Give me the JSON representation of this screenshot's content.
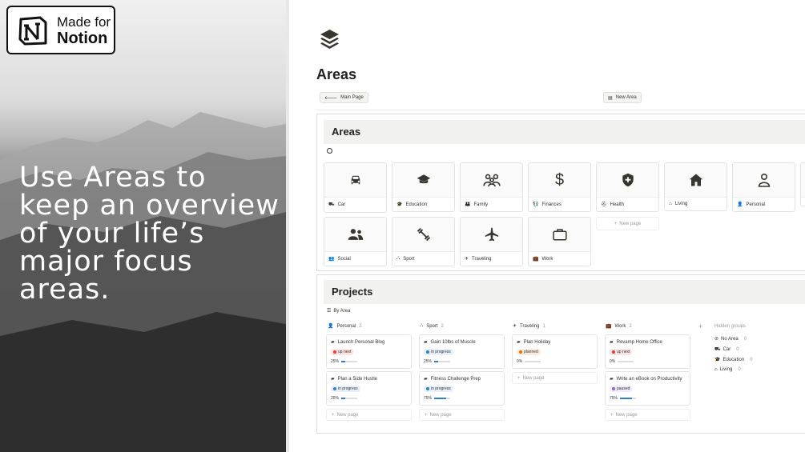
{
  "badge": {
    "line1": "Made for",
    "line2": "Notion",
    "logo_icon": "notion-logo-icon"
  },
  "headline": "Use Areas to keep an overview of your life’s major focus areas.",
  "page": {
    "title": "Areas",
    "icon": "layers-icon",
    "buttons": {
      "main_page": "Main Page",
      "new_area": "New Area"
    }
  },
  "areas": {
    "header": "Areas",
    "cards": [
      {
        "label": "Car",
        "icon": "car-icon"
      },
      {
        "label": "Education",
        "icon": "graduation-cap-icon"
      },
      {
        "label": "Family",
        "icon": "family-icon"
      },
      {
        "label": "Finances",
        "icon": "dollar-icon"
      },
      {
        "label": "Health",
        "icon": "shield-plus-icon"
      },
      {
        "label": "Living",
        "icon": "home-icon"
      },
      {
        "label": "Personal",
        "icon": "person-icon"
      },
      {
        "label": "Social",
        "icon": "people-icon"
      },
      {
        "label": "Sport",
        "icon": "dumbbell-icon"
      },
      {
        "label": "Traveling",
        "icon": "airplane-icon"
      },
      {
        "label": "Work",
        "icon": "briefcase-icon"
      }
    ],
    "new_page": "New page"
  },
  "projects": {
    "header": "Projects",
    "view": "By Area",
    "hidden_groups_label": "Hidden groups",
    "new_page": "New page",
    "columns": [
      {
        "name": "Personal",
        "count": "2",
        "cards": [
          {
            "title": "Launch Personal Blog",
            "status": "up next",
            "progress": 0.25,
            "progress_label": "25%"
          },
          {
            "title": "Plan a Side Hustle",
            "status": "in progress",
            "progress": 0.25,
            "progress_label": "25%"
          }
        ]
      },
      {
        "name": "Sport",
        "count": "2",
        "cards": [
          {
            "title": "Gain 10lbs of Muscle",
            "status": "in progress",
            "progress": 0.25,
            "progress_label": "25%"
          },
          {
            "title": "Fitness Challenge Prep",
            "status": "in progress",
            "progress": 0.75,
            "progress_label": "75%"
          }
        ]
      },
      {
        "name": "Traveling",
        "count": "1",
        "cards": [
          {
            "title": "Plan Holiday",
            "status": "planned",
            "progress": 0,
            "progress_label": "0%"
          }
        ]
      },
      {
        "name": "Work",
        "count": "2",
        "cards": [
          {
            "title": "Revamp Home Office",
            "status": "up next",
            "progress": 0,
            "progress_label": "0%"
          },
          {
            "title": "Write an eBook on Productivity",
            "status": "paused",
            "progress": 0.75,
            "progress_label": "75%"
          }
        ]
      }
    ],
    "hidden_groups": [
      {
        "name": "No Area",
        "count": "0"
      },
      {
        "name": "Car",
        "count": "0"
      },
      {
        "name": "Education",
        "count": "0"
      },
      {
        "name": "Living",
        "count": "0"
      }
    ]
  },
  "status_colors": {
    "up next": {
      "bg": "#fbe4e4",
      "dot": "#e03e3e"
    },
    "in progress": {
      "bg": "#e7f0fa",
      "dot": "#2f7fc1"
    },
    "planned": {
      "bg": "#fbecdd",
      "dot": "#d9730d"
    },
    "paused": {
      "bg": "#f1eafa",
      "dot": "#9065b0"
    }
  }
}
